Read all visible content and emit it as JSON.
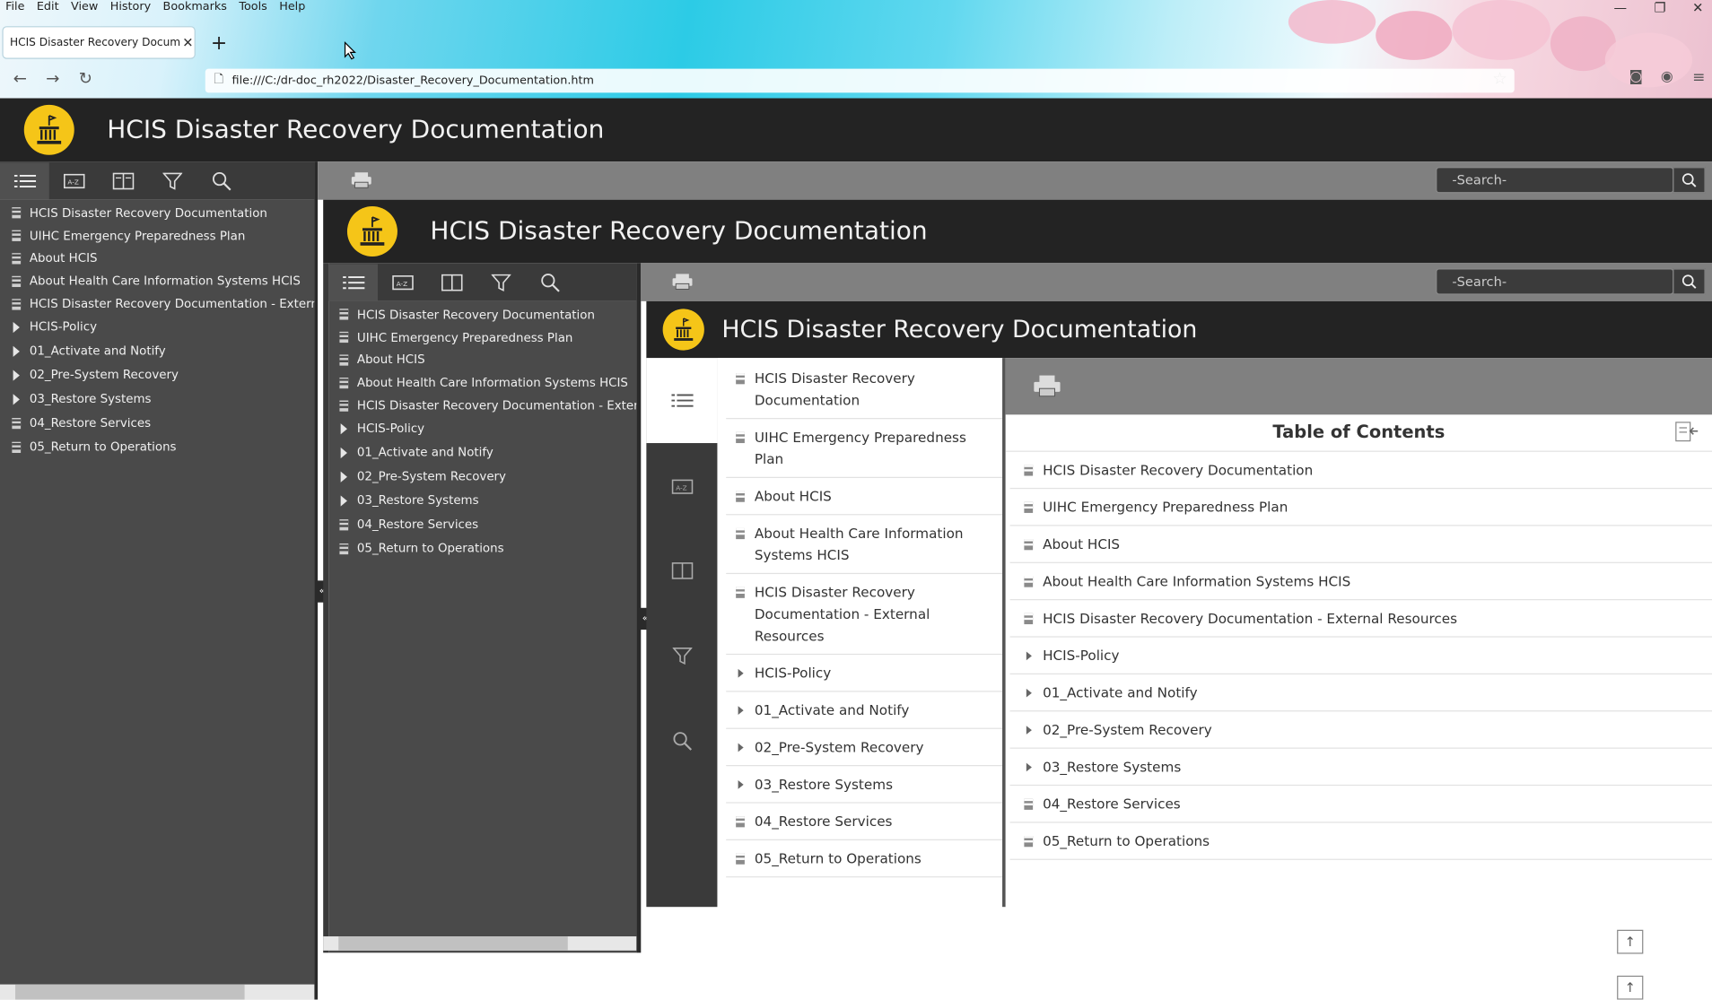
{
  "browser": {
    "menu": [
      "File",
      "Edit",
      "View",
      "History",
      "Bookmarks",
      "Tools",
      "Help"
    ],
    "tab_title": "HCIS Disaster Recovery Documentation",
    "new_tab": "+",
    "close_tab": "✕",
    "url": "file:///C:/dr-doc_rh2022/Disaster_Recovery_Documentation.htm"
  },
  "header": {
    "title": "HCIS Disaster Recovery Documentation"
  },
  "search": {
    "placeholder": "-Search-"
  },
  "toc_title": "Table of Contents",
  "nav": [
    {
      "label": "HCIS Disaster Recovery Documentation",
      "type": "doc"
    },
    {
      "label": "UIHC Emergency Preparedness Plan",
      "type": "doc"
    },
    {
      "label": "About HCIS",
      "type": "doc"
    },
    {
      "label": "About Health Care Information Systems HCIS",
      "type": "doc"
    },
    {
      "label": "HCIS Disaster Recovery Documentation - External Resources",
      "type": "doc"
    },
    {
      "label": "HCIS-Policy",
      "type": "folder"
    },
    {
      "label": "01_Activate and Notify",
      "type": "folder"
    },
    {
      "label": "02_Pre-System Recovery",
      "type": "folder"
    },
    {
      "label": "03_Restore Systems",
      "type": "folder"
    },
    {
      "label": "04_Restore Services",
      "type": "doc"
    },
    {
      "label": "05_Return to Operations",
      "type": "doc"
    }
  ],
  "colors": {
    "header_bg": "#232323",
    "logo": "#f5c518",
    "nav_bg": "#4a4a4a",
    "toolbar": "#3a3a3a"
  }
}
